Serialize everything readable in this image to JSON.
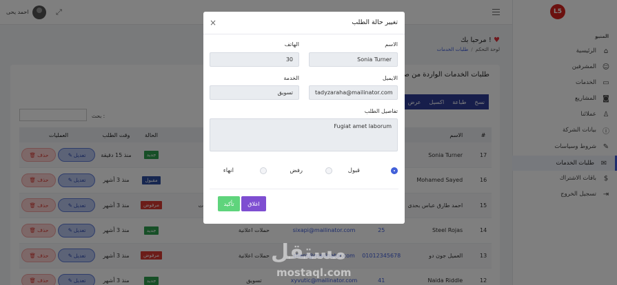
{
  "header": {
    "user_name": "احمد يحى",
    "icons": [
      "expand-icon",
      "menu-icon"
    ]
  },
  "sidebar": {
    "logo": "L5",
    "menu_title": "المنيو",
    "items": [
      {
        "label": "الرئيسية",
        "icon": "home-icon"
      },
      {
        "label": "المشرفين",
        "icon": "users-icon"
      },
      {
        "label": "الخدمات",
        "icon": "services-icon"
      },
      {
        "label": "المشاريع",
        "icon": "camera-icon"
      },
      {
        "label": "عملائنا",
        "icon": "user-plus-icon"
      },
      {
        "label": "بيانات الشركة",
        "icon": "info-icon"
      },
      {
        "label": "شروط وسياسات",
        "icon": "edit-icon"
      },
      {
        "label": "طلبات الخدمات",
        "icon": "mail-icon"
      },
      {
        "label": "باقات الاشتراك",
        "icon": "dollar-icon"
      },
      {
        "label": "تسجيل الخروج",
        "icon": "logout-icon"
      }
    ],
    "active_index": 7
  },
  "page": {
    "welcome": "مرحبا بك !",
    "breadcrumb": [
      "لوحة التحكم",
      "طلبات الخدمات"
    ],
    "card_title": "طلبات الخدمات الواردة من صفح",
    "export_buttons": [
      "نسخ",
      "طباعة",
      "اكسيل",
      "عرض"
    ],
    "search_label": "بحث :"
  },
  "table": {
    "headers": [
      "#",
      "الاسم",
      "",
      "",
      "",
      "",
      "الحالة",
      "وقت الطلب",
      "العمليات"
    ],
    "edit_label": "تعديل",
    "delete_label": "حذف",
    "rows": [
      {
        "num": "17",
        "name": "Sonia Turner",
        "phone": "",
        "email": "",
        "service": "",
        "details": "",
        "status": "جديد",
        "status_type": "new",
        "time": "منذ 15 دقيقة"
      },
      {
        "num": "16",
        "name": "Mohamed Sayed",
        "phone": "",
        "email": "",
        "service": "",
        "details": "",
        "status": "مقبول",
        "status_type": "accepted",
        "time": "منذ 3 أشهر"
      },
      {
        "num": "15",
        "name": "احمد طارق عباس بحدى",
        "phone": "",
        "email": "",
        "service": "",
        "details": "تطبيقات",
        "status": "مرفوض",
        "status_type": "rejected",
        "time": "منذ 3 أشهر"
      },
      {
        "num": "14",
        "name": "Steel Rojas",
        "phone": "25",
        "email": "sixapi@mailinator.com",
        "service": "حملات اعلانية",
        "details": "",
        "status": "جديد",
        "status_type": "new",
        "time": "منذ 3 أشهر"
      },
      {
        "num": "13",
        "name": "العميل جون دو",
        "phone": "01012345678",
        "email": "client@mailinator.com",
        "service": "حملات اعلانية",
        "details": "",
        "status": "مرفوض",
        "status_type": "rejected",
        "time": "منذ 3 أشهر"
      },
      {
        "num": "12",
        "name": "Naida Riddle",
        "phone": "41",
        "email": "xyvutic@mailinator.com",
        "service": "تسويق",
        "details": "",
        "status": "جديد",
        "status_type": "new",
        "time": "منذ 3 أشهر"
      }
    ]
  },
  "modal": {
    "title": "تغيير حالة الطلب",
    "fields": {
      "name_label": "الاسم",
      "name_value": "Sonia Turner",
      "phone_label": "الهاتف",
      "phone_value": "30",
      "email_label": "الايميل",
      "email_value": "tadyzaraha@mailinator.com",
      "service_label": "الخدمة",
      "service_value": "تسويق",
      "details_label": "تفاصيل الطلب",
      "details_value": "Fugiat amet laborum"
    },
    "radio_options": [
      "قبول",
      "رفض",
      "انهاء"
    ],
    "selected_option": "قبول",
    "close_label": "اغلاق",
    "confirm_label": "تأكيد"
  },
  "watermark": {
    "logo_text": "مستقل",
    "url": "mostaql.com"
  },
  "colors": {
    "primary": "#3c5bd8",
    "export_bar": "#2f3d97",
    "status_new": "#2e9e4f",
    "status_accepted": "#2f4fa0",
    "status_rejected": "#d83a33",
    "close_button": "#7e4ed1",
    "confirm_button": "#5fd47c"
  }
}
